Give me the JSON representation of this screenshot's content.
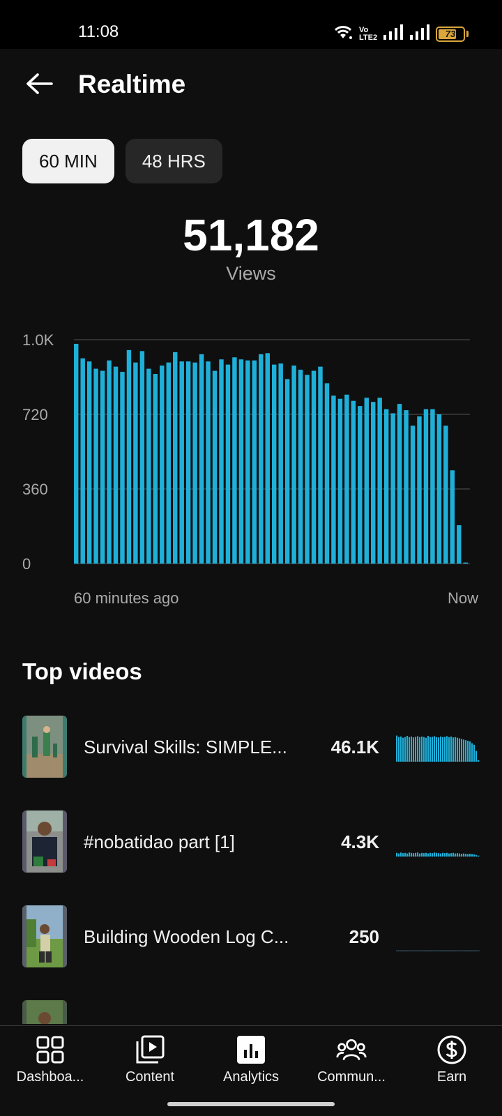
{
  "status_bar": {
    "time": "11:08",
    "battery_level": "73",
    "network_label": "Vo LTE2",
    "icons": [
      "wifi-icon",
      "volte-icon",
      "signal-icon",
      "signal-icon",
      "battery-icon"
    ]
  },
  "header": {
    "back_icon": "arrow-left-icon",
    "title": "Realtime"
  },
  "range_chips": [
    {
      "label": "60 MIN",
      "selected": true
    },
    {
      "label": "48 HRS",
      "selected": false
    }
  ],
  "summary": {
    "total_views": "51,182",
    "views_label": "Views"
  },
  "chart_data": {
    "type": "bar",
    "x_start_label": "60 minutes ago",
    "x_end_label": "Now",
    "y_ticks": [
      "0",
      "360",
      "720",
      "1.0K"
    ],
    "y_tick_values": [
      0,
      360,
      720,
      1080
    ],
    "ylim": [
      0,
      1080
    ],
    "grid": true,
    "bar_color": "#1fb0d9",
    "values": [
      1060,
      990,
      975,
      940,
      930,
      980,
      950,
      925,
      1030,
      970,
      1025,
      940,
      915,
      955,
      970,
      1020,
      975,
      975,
      970,
      1010,
      975,
      930,
      985,
      960,
      995,
      985,
      980,
      980,
      1010,
      1015,
      960,
      965,
      890,
      955,
      935,
      910,
      930,
      950,
      870,
      810,
      795,
      815,
      785,
      760,
      800,
      780,
      800,
      745,
      725,
      770,
      740,
      665,
      710,
      745,
      745,
      720,
      665,
      450,
      185,
      5
    ]
  },
  "top_videos": {
    "title": "Top videos",
    "items": [
      {
        "title": "Survival Skills: SIMPLE...",
        "views": "46.1K",
        "spark": [
          0.85,
          0.8,
          0.82,
          0.78,
          0.8,
          0.84,
          0.8,
          0.82,
          0.79,
          0.81,
          0.83,
          0.8,
          0.82,
          0.8,
          0.78,
          0.84,
          0.8,
          0.81,
          0.83,
          0.8,
          0.79,
          0.82,
          0.8,
          0.81,
          0.83,
          0.8,
          0.82,
          0.79,
          0.8,
          0.78,
          0.76,
          0.74,
          0.72,
          0.7,
          0.68,
          0.66,
          0.6,
          0.55,
          0.35,
          0.05
        ],
        "spark_color": "#1fb0d9"
      },
      {
        "title": "#nobatidao part [1]",
        "views": "4.3K",
        "spark": [
          0.12,
          0.1,
          0.13,
          0.11,
          0.12,
          0.1,
          0.13,
          0.12,
          0.11,
          0.12,
          0.13,
          0.1,
          0.12,
          0.11,
          0.12,
          0.1,
          0.12,
          0.11,
          0.13,
          0.12,
          0.11,
          0.1,
          0.12,
          0.11,
          0.12,
          0.1,
          0.11,
          0.12,
          0.1,
          0.11,
          0.1,
          0.09,
          0.1,
          0.09,
          0.08,
          0.09,
          0.08,
          0.07,
          0.05,
          0.02
        ],
        "spark_color": "#1fb0d9"
      },
      {
        "title": "Building Wooden Log C...",
        "views": "250",
        "spark": [
          0.02,
          0.01,
          0.02,
          0.01,
          0.02,
          0.01,
          0.02,
          0.01,
          0.02,
          0.01,
          0.02,
          0.01,
          0.02,
          0.01,
          0.02,
          0.01,
          0.02,
          0.01,
          0.02,
          0.01,
          0.02,
          0.01,
          0.02,
          0.01,
          0.02,
          0.01,
          0.02,
          0.01,
          0.02,
          0.01,
          0.02,
          0.01,
          0.02,
          0.01,
          0.02,
          0.01,
          0.02,
          0.01,
          0.02,
          0.01
        ],
        "spark_color": "#2a4a55"
      },
      {
        "title": "...",
        "views": "...",
        "spark": [],
        "spark_color": "#2a4a55"
      }
    ]
  },
  "bottom_nav": [
    {
      "label": "Dashboa...",
      "icon": "dashboard-icon",
      "active": false
    },
    {
      "label": "Content",
      "icon": "content-icon",
      "active": false
    },
    {
      "label": "Analytics",
      "icon": "analytics-icon",
      "active": true
    },
    {
      "label": "Commun...",
      "icon": "community-icon",
      "active": false
    },
    {
      "label": "Earn",
      "icon": "earn-icon",
      "active": false
    }
  ]
}
